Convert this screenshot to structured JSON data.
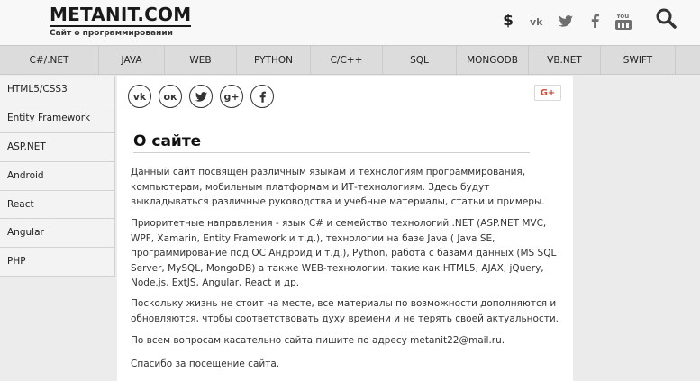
{
  "header": {
    "logo_title": "METANIT.COM",
    "logo_subtitle": "Сайт о программировании",
    "social": [
      {
        "icon": "dollar-icon",
        "glyph": "$"
      },
      {
        "icon": "vk-icon",
        "glyph": "vk"
      },
      {
        "icon": "twitter-icon",
        "glyph": "t"
      },
      {
        "icon": "facebook-icon",
        "glyph": "f"
      },
      {
        "icon": "youtube-icon",
        "glyph": "You"
      }
    ]
  },
  "nav": {
    "items": [
      "C#/.NET",
      "JAVA",
      "WEB",
      "PYTHON",
      "C/C++",
      "SQL",
      "MONGODB",
      "VB.NET",
      "SWIFT"
    ]
  },
  "sidebar": {
    "items": [
      "HTML5/CSS3",
      "Entity Framework",
      "ASP.NET",
      "Android",
      "React",
      "Angular",
      "PHP"
    ]
  },
  "share": {
    "buttons": [
      {
        "icon": "vk-icon",
        "glyph": "vk"
      },
      {
        "icon": "odnoklassniki-icon",
        "glyph": "ок"
      },
      {
        "icon": "twitter-icon",
        "glyph": "t"
      },
      {
        "icon": "google-plus-icon",
        "glyph": "g+"
      },
      {
        "icon": "facebook-icon",
        "glyph": "f"
      }
    ],
    "gplus_label": "G+"
  },
  "main": {
    "title": "О сайте",
    "paragraphs": [
      "Данный сайт посвящен различным языкам и технологиям программирования, компьютерам, мобильным платформам и ИТ-технологиям. Здесь будут выкладываться различные руководства и учебные материалы, статьи и примеры.",
      "Приоритетные направления - язык C# и семейство технологий .NET (ASP.NET MVC, WPF, Xamarin, Entity Framework и т.д.), технологии на базе Java ( Java SE, программирование под ОС Андроид и т.д.), Python, работа с базами данных (MS SQL Server, MySQL, MongoDB) а также WEB-технологии, такие как HTML5, AJAX, jQuery, Node.js, ExtJS, Angular, React и др.",
      "Поскольку жизнь не стоит на месте, все материалы по возможности дополняются и обновляются, чтобы соответствовать духу времени и не терять своей актуальности.",
      "По всем вопросам касательно сайта пишите по адресу metanit22@mail.ru.",
      "Спасибо за посещение сайта."
    ]
  }
}
